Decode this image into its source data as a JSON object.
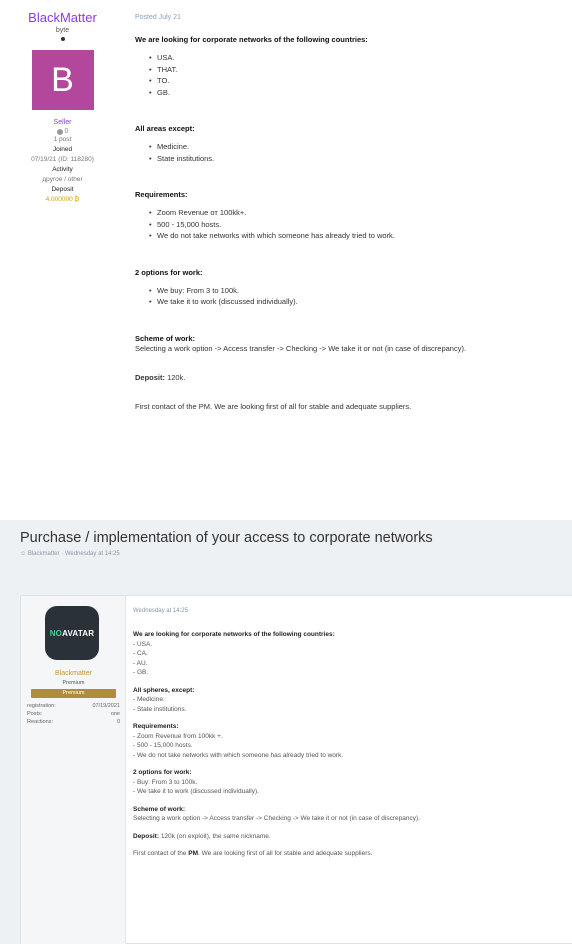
{
  "top_post": {
    "user": {
      "name": "BlackMatter",
      "status": "byte",
      "avatar_letter": "B",
      "role": "Seller",
      "reputation": "0",
      "posts": "1 post",
      "joined_label": "Joined",
      "joined_value": "07/19/21 (ID: 118280)",
      "activity_label": "Activity",
      "activity_value": "другое / other",
      "deposit_label": "Deposit",
      "deposit_value": "4.000000 ₿"
    },
    "date": "Posted July 21",
    "countries_heading": "We are looking for corporate networks of the following countries:",
    "countries": [
      "USA.",
      "THAT.",
      "TO.",
      "GB."
    ],
    "areas_heading": "All areas except:",
    "areas": [
      "Medicine.",
      "State institutions."
    ],
    "requirements_heading": "Requirements:",
    "requirements": [
      "Zoom Revenue от 100kk+.",
      "500 - 15,000 hosts.",
      "We do not take networks with which someone has already tried to work."
    ],
    "options_heading": "2 options for work:",
    "options": [
      "We buy: From 3 to 100k.",
      "We take it to work (discussed individually)."
    ],
    "scheme_heading": "Scheme of work:",
    "scheme_text": "Selecting a work option -> Access transfer -> Checking -> We take it or not (in case of discrepancy).",
    "deposit_heading": "Deposit:",
    "deposit_text": "120k.",
    "contact_text": "First contact of the PM. We are looking first of all for stable and adequate suppliers."
  },
  "thread": {
    "title": "Purchase / implementation of your access to corporate networks",
    "meta": "Blackmatter · Wednesday at 14:25",
    "user": {
      "avatar_text_1": "NO",
      "avatar_text_2": "AVATAR",
      "name": "Blackmatter",
      "rank": "Premium",
      "badge": "Premium",
      "stats": [
        {
          "label": "registration:",
          "value": "07/19/2021"
        },
        {
          "label": "Posts:",
          "value": "one"
        },
        {
          "label": "Reactions:",
          "value": "0"
        }
      ]
    },
    "post": {
      "date": "Wednesday at 14:25",
      "countries_heading": "We are looking for corporate networks of the following countries:",
      "countries": [
        "- USA.",
        "- CA.",
        "- AU.",
        "- GB."
      ],
      "areas_heading": "All spheres, except:",
      "areas": [
        "- Medicine.",
        "- State institutions."
      ],
      "requirements_heading": "Requirements:",
      "requirements": [
        "- Zoom Revenue from 100kk +.",
        "- 500 - 15,000 hosts.",
        "- We do not take networks with which someone has already tried to work."
      ],
      "options_heading": "2 options for work:",
      "options": [
        "- Buy: From 3 to 100k.",
        "- We take it to work (discussed individually)."
      ],
      "scheme_heading": "Scheme of work:",
      "scheme_text": "Selecting a work option -> Access transfer -> Checking -> We take it or not (in case of discrepancy).",
      "deposit_label": "Deposit:",
      "deposit_text": "120k (on exploit), the same nickname.",
      "contact_pre": "First contact of the",
      "contact_pm": "PM",
      "contact_post": ". We are looking first of all for stable and adequate suppliers."
    }
  }
}
